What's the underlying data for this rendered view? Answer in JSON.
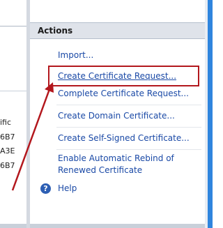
{
  "left_panel": {
    "cells": [
      "ific",
      "6B7",
      "A3E",
      "6B7"
    ]
  },
  "actions": {
    "header": "Actions",
    "items": [
      {
        "label": "Import..."
      },
      {
        "label": "Create Certificate Request..."
      },
      {
        "label": "Complete Certificate Request..."
      },
      {
        "label": "Create Domain Certificate..."
      },
      {
        "label": "Create Self-Signed Certificate..."
      },
      {
        "label": "Enable Automatic Rebind of"
      },
      {
        "label": "Renewed Certificate"
      },
      {
        "label": "Help"
      }
    ]
  },
  "colors": {
    "link": "#1a49a6",
    "highlight_border": "#b3171d",
    "arrow": "#b3171d",
    "header_bg": "#dfe3ea",
    "edge_blue": "#2f85de"
  },
  "icons": {
    "help": "question-circle"
  }
}
